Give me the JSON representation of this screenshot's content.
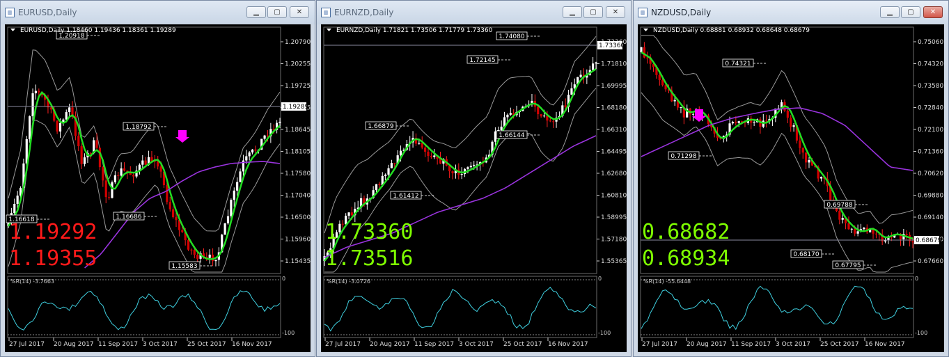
{
  "windows": [
    {
      "title": "EURUSD,Daily",
      "active": false,
      "header": "EURUSD,Daily  1.18460 1.19436 1.18361 1.19289",
      "price_labels": [
        "1.20790",
        "1.20255",
        "1.19725",
        "1.19185",
        "1.18645",
        "1.18105",
        "1.17580",
        "1.17040",
        "1.16500",
        "1.15960",
        "1.15435"
      ],
      "current_price": "1.19289",
      "bid": "1.19292",
      "ask": "1.19355",
      "bid_color": "#ff1a1a",
      "annotations": [
        "1.20918",
        "1.18792",
        "1.16618",
        "1.16686",
        "1.15583"
      ],
      "indicator_label": "%R(14) -3.7663",
      "indicator_scale": [
        "0",
        "-100"
      ],
      "dates": [
        "27 Jul 2017",
        "20 Aug 2017",
        "11 Sep 2017",
        "3 Oct 2017",
        "25 Oct 2017",
        "16 Nov 2017"
      ],
      "arrow_color": "#ff00ff"
    },
    {
      "title": "EURNZD,Daily",
      "active": false,
      "header": "EURNZD,Daily  1.71821 1.73506 1.71779 1.73360",
      "price_labels": [
        "1.73360",
        "1.71810",
        "1.69995",
        "1.68180",
        "1.66310",
        "1.64495",
        "1.62680",
        "1.60810",
        "1.58995",
        "1.57180",
        "1.55365"
      ],
      "current_price": "1.73360",
      "bid": "1.73360",
      "ask": "1.73516",
      "bid_color": "#7fff00",
      "annotations": [
        "1.74080",
        "1.72145",
        "1.66879",
        "1.66144",
        "1.61412"
      ],
      "indicator_label": "%R(14) -3.0726",
      "indicator_scale": [
        "0",
        "-100"
      ],
      "dates": [
        "27 Jul 2017",
        "20 Aug 2017",
        "11 Sep 2017",
        "3 Oct 2017",
        "25 Oct 2017",
        "16 Nov 2017"
      ],
      "arrow_color": ""
    },
    {
      "title": "NZDUSD,Daily",
      "active": true,
      "header": "NZDUSD,Daily  0.68881 0.68932 0.68648 0.68679",
      "price_labels": [
        "0.75060",
        "0.74320",
        "0.73580",
        "0.72840",
        "0.72100",
        "0.71360",
        "0.70620",
        "0.69880",
        "0.69140",
        "0.68400",
        "0.67660"
      ],
      "current_price": "0.68679",
      "bid": "0.68682",
      "ask": "0.68934",
      "bid_color": "#7fff00",
      "annotations": [
        "0.74321",
        "0.71298",
        "0.69788",
        "0.68170",
        "0.67795"
      ],
      "indicator_label": "%R(14) -55.6448",
      "indicator_scale": [
        "0",
        "-100"
      ],
      "dates": [
        "27 Jul 2017",
        "20 Aug 2017",
        "11 Sep 2017",
        "3 Oct 2017",
        "25 Oct 2017",
        "16 Nov 2017"
      ],
      "arrow_color": "#ff00ff"
    }
  ]
}
